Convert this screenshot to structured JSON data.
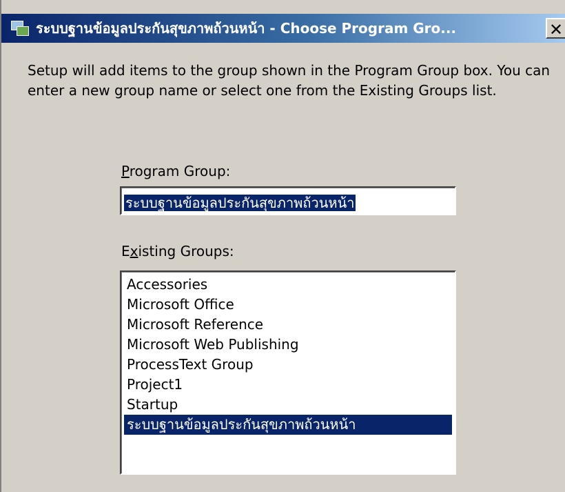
{
  "window": {
    "title": "ระบบฐานข้อมูลประกันสุขภาพถ้วนหน้า - Choose Program Gro...",
    "close_label": "✕"
  },
  "description": "Setup will add items to the group shown in the Program Group box. You can enter a new group name or select one from the Existing Groups list.",
  "program_group": {
    "label_prefix": "P",
    "label_rest": "rogram Group:",
    "value": "ระบบฐานข้อมูลประกันสุขภาพถ้วนหน้า"
  },
  "existing_groups": {
    "label_prefix": "E",
    "label_accel": "x",
    "label_rest": "isting Groups:",
    "items": [
      "Accessories",
      "Microsoft Office",
      "Microsoft Reference",
      "Microsoft Web Publishing",
      "ProcessText Group",
      "Project1",
      "Startup",
      "ระบบฐานข้อมูลประกันสุขภาพถ้วนหน้า"
    ],
    "selected_index": 7
  }
}
